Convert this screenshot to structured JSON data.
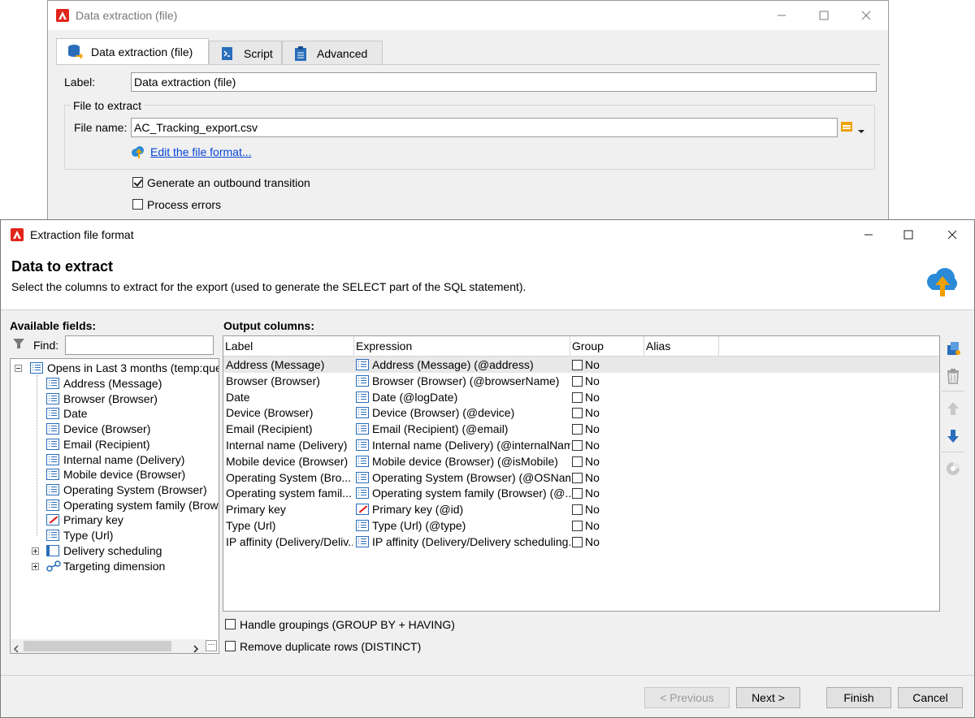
{
  "back_window": {
    "title": "Data extraction (file)",
    "tabs": [
      {
        "label": "Data extraction (file)",
        "icon": "database-icon"
      },
      {
        "label": "Script",
        "icon": "script-icon"
      },
      {
        "label": "Advanced",
        "icon": "clipboard-icon"
      }
    ],
    "label_caption": "Label:",
    "label_value": "Data extraction (file)",
    "file_group_title": "File to extract",
    "file_name_caption": "File name:",
    "file_name_value": "AC_Tracking_export.csv",
    "edit_format_link": "Edit the file format...",
    "generate_transition_label": "Generate an outbound transition",
    "generate_transition_checked": true,
    "process_errors_label": "Process errors",
    "process_errors_checked": false
  },
  "dialog": {
    "title": "Extraction file format",
    "heading": "Data to extract",
    "description": "Select the columns to extract for the export (used to generate the SELECT part of the SQL statement).",
    "available_fields_label": "Available fields:",
    "find_label": "Find:",
    "find_value": "",
    "tree_root": "Opens in Last 3 months (temp:que",
    "tree_children": [
      {
        "label": "Address (Message)",
        "icon": "list-icon"
      },
      {
        "label": "Browser (Browser)",
        "icon": "list-icon"
      },
      {
        "label": "Date",
        "icon": "list-icon"
      },
      {
        "label": "Device (Browser)",
        "icon": "list-icon"
      },
      {
        "label": "Email (Recipient)",
        "icon": "list-icon"
      },
      {
        "label": "Internal name (Delivery)",
        "icon": "list-icon"
      },
      {
        "label": "Mobile device (Browser)",
        "icon": "list-icon"
      },
      {
        "label": "Operating System (Browser)",
        "icon": "list-icon"
      },
      {
        "label": "Operating system family (Brow",
        "icon": "list-icon"
      },
      {
        "label": "Primary key",
        "icon": "key-icon"
      },
      {
        "label": "Type (Url)",
        "icon": "list-icon"
      }
    ],
    "tree_collapsed": [
      {
        "label": "Delivery scheduling",
        "icon": "link-table-icon"
      },
      {
        "label": "Targeting dimension",
        "icon": "join-icon"
      }
    ],
    "output_columns_label": "Output columns:",
    "columns": [
      "Label",
      "Expression",
      "Group",
      "Alias"
    ],
    "rows": [
      {
        "label": "Address (Message)",
        "expression": "Address (Message) (@address)",
        "group": "No",
        "alias": ""
      },
      {
        "label": "Browser (Browser)",
        "expression": "Browser (Browser) (@browserName)",
        "group": "No",
        "alias": ""
      },
      {
        "label": "Date",
        "expression": "Date (@logDate)",
        "group": "No",
        "alias": ""
      },
      {
        "label": "Device (Browser)",
        "expression": "Device (Browser) (@device)",
        "group": "No",
        "alias": ""
      },
      {
        "label": "Email (Recipient)",
        "expression": "Email (Recipient) (@email)",
        "group": "No",
        "alias": ""
      },
      {
        "label": "Internal name (Delivery)",
        "expression": "Internal name (Delivery) (@internalNam",
        "group": "No",
        "alias": ""
      },
      {
        "label": "Mobile device (Browser)",
        "expression": "Mobile device (Browser) (@isMobile)",
        "group": "No",
        "alias": ""
      },
      {
        "label": "Operating System (Bro...",
        "expression": "Operating System (Browser) (@OSNam...",
        "group": "No",
        "alias": ""
      },
      {
        "label": "Operating system famil...",
        "expression": "Operating system family (Browser) (@...",
        "group": "No",
        "alias": ""
      },
      {
        "label": "Primary key",
        "expression": "Primary key (@id)",
        "group": "No",
        "alias": ""
      },
      {
        "label": "Type (Url)",
        "expression": "Type (Url) (@type)",
        "group": "No",
        "alias": ""
      },
      {
        "label": "IP affinity (Delivery/Deliv...",
        "expression": "IP affinity (Delivery/Delivery scheduling...",
        "group": "No",
        "alias": ""
      }
    ],
    "handle_groupings_label": "Handle groupings (GROUP BY + HAVING)",
    "remove_duplicates_label": "Remove duplicate rows (DISTINCT)",
    "buttons": {
      "previous": "< Previous",
      "next": "Next >",
      "finish": "Finish",
      "cancel": "Cancel"
    }
  },
  "colors": {
    "accent_red": "#e1251b",
    "link_blue": "#0645d6",
    "icon_blue": "#2a6ebb",
    "selected_row": "#e8e8e8"
  }
}
